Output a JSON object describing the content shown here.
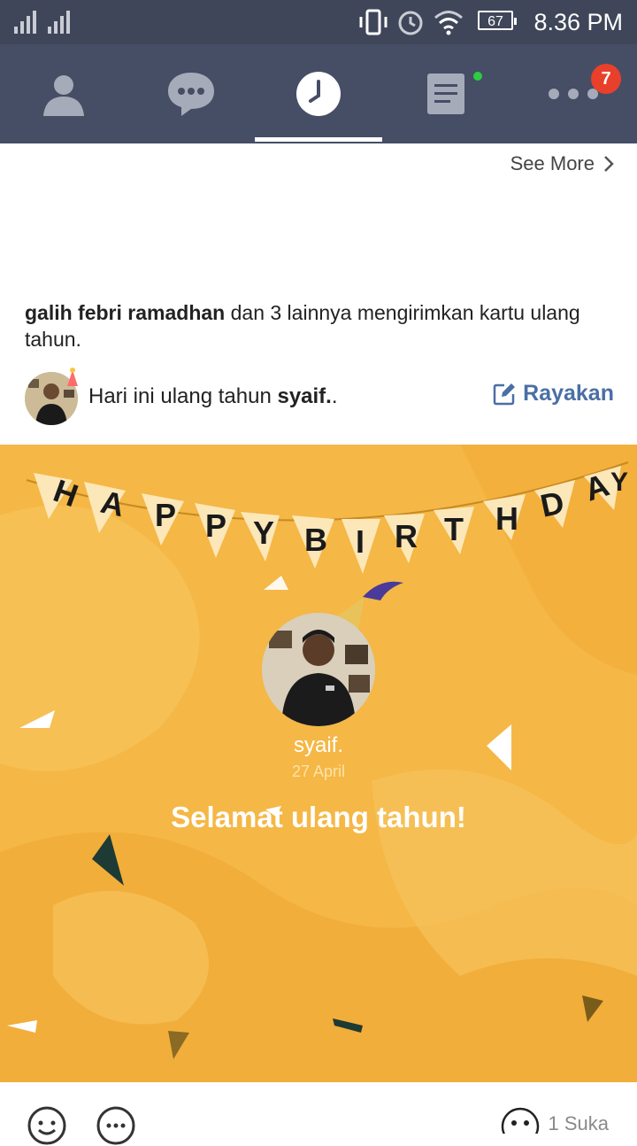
{
  "status_bar": {
    "time": "8.36 PM",
    "battery": "67"
  },
  "tabs": [
    {
      "name": "friends",
      "icon": "person-icon"
    },
    {
      "name": "chats",
      "icon": "chat-bubble-icon"
    },
    {
      "name": "timeline",
      "icon": "clock-icon",
      "active": true
    },
    {
      "name": "news",
      "icon": "news-icon",
      "has_dot": true
    },
    {
      "name": "more",
      "icon": "more-icon",
      "badge": "7"
    }
  ],
  "see_more": "See More",
  "notice": {
    "sender": "galih febri ramadhan",
    "rest": " dan 3 lainnya mengirimkan kartu ulang tahun."
  },
  "birthday_row": {
    "prefix": "Hari ini ulang tahun ",
    "name": "syaif.",
    "suffix": ".",
    "action": "Rayakan"
  },
  "card": {
    "banner": "HAPPY BIRTHDAY",
    "name": "syaif.",
    "date": "27 April",
    "greeting": "Selamat ulang tahun!"
  },
  "footer": {
    "likes": "1 Suka"
  },
  "colors": {
    "status_bar": "#3f4659",
    "tab_bar": "#464e66",
    "card_bg": "#f5b745",
    "accent_link": "#4a6fa5",
    "badge": "#e8402a"
  }
}
